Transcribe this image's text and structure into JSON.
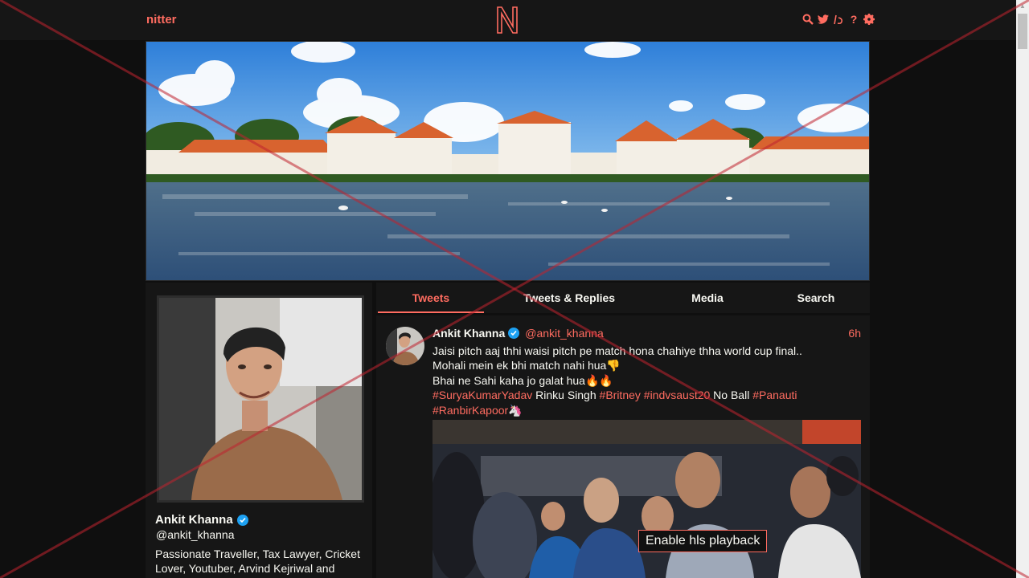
{
  "nav": {
    "brand": "nitter",
    "logo_letter": "N",
    "icons": [
      "search-icon",
      "twitter-icon",
      "rss-icon",
      "help-icon",
      "gear-icon"
    ],
    "help_glyph": "?"
  },
  "colors": {
    "accent": "#ff6c60",
    "background": "#0f0f0f",
    "panel": "#161616",
    "text": "#f8f8f2",
    "verified": "#1da1f2"
  },
  "profile": {
    "fullname": "Ankit Khanna",
    "username": "@ankit_khanna",
    "bio": "Passionate Traveller, Tax Lawyer, Cricket Lover,  Youtuber, Arvind Kejriwal and"
  },
  "tabs": [
    {
      "label": "Tweets",
      "active": true
    },
    {
      "label": "Tweets & Replies",
      "active": false
    },
    {
      "label": "Media",
      "active": false
    },
    {
      "label": "Search",
      "active": false
    }
  ],
  "tweet": {
    "fullname": "Ankit Khanna",
    "username": "@ankit_khanna",
    "date": "6h",
    "line1": "Jaisi pitch aaj thhi waisi pitch pe match hona chahiye thha world cup final..",
    "line2": "Mohali mein ek bhi match nahi hua",
    "line2_emoji": "👎",
    "line3": "Bhai ne Sahi kaha jo galat hua",
    "line3_emoji": "🔥🔥",
    "hashtag1": "#SuryaKumarYadav",
    "plain1": " Rinku Singh ",
    "hashtag2": "#Britney",
    "hashtag3": "#indvsaust20",
    "plain2": " No Ball ",
    "hashtag4": "#Panauti",
    "hashtag5": "#RanbirKapoor",
    "last_emoji": "🦄",
    "media_button": "Enable hls playback"
  }
}
